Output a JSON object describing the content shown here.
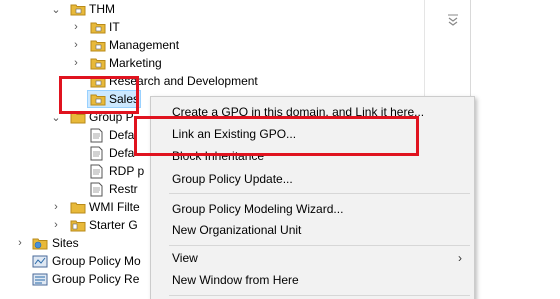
{
  "tree": {
    "thm": "THM",
    "it": "IT",
    "management": "Management",
    "marketing": "Marketing",
    "research": "Research and Development",
    "sales": "Sales",
    "group_policy_objects": "Group P",
    "default1": "Defa",
    "default2": "Defa",
    "rdp": "RDP p",
    "restricted": "Restr",
    "wmi_filters": "WMI Filte",
    "starter_gpos": "Starter G",
    "sites": "Sites",
    "gp_modeling": "Group Policy Mo",
    "gp_results": "Group Policy Re"
  },
  "menu": {
    "create_gpo": "Create a GPO in this domain, and Link it here...",
    "link_existing": "Link an Existing GPO...",
    "block_inheritance": "Block Inheritance",
    "gp_update": "Group Policy Update...",
    "modeling_wizard": "Group Policy Modeling Wizard...",
    "new_ou": "New Organizational Unit",
    "view": "View",
    "new_window": "New Window from Here"
  },
  "colors": {
    "highlight": "#e0131f",
    "selection": "#cce8ff",
    "folder": "#e8b93a"
  }
}
